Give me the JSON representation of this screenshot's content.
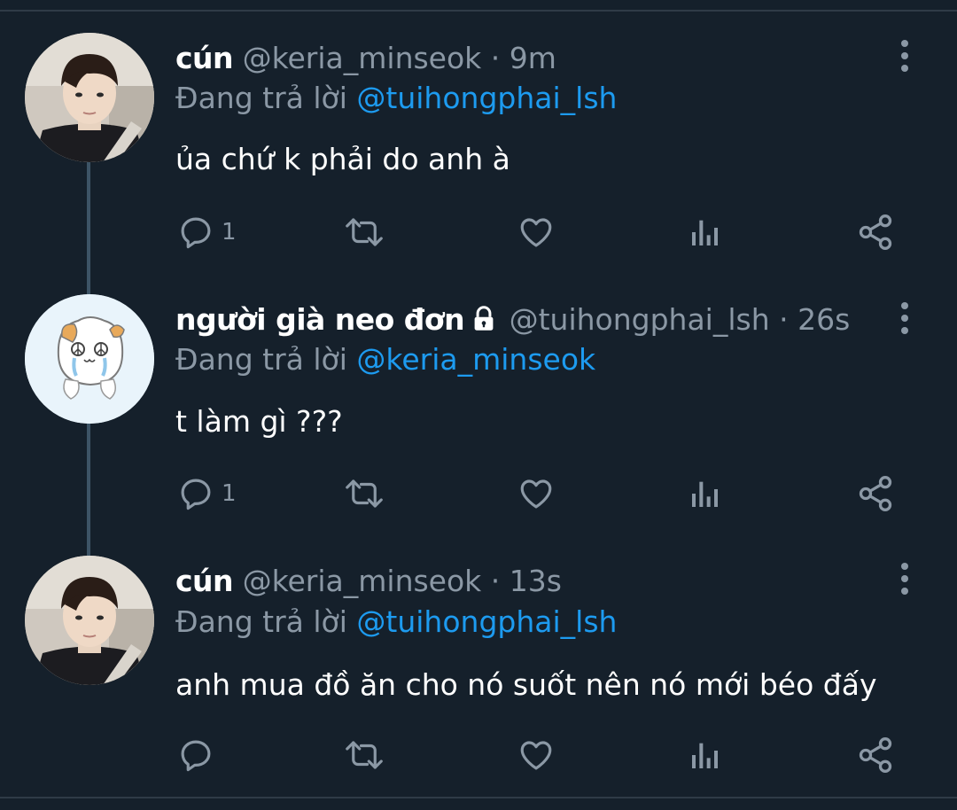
{
  "tweets": [
    {
      "name": "cún",
      "handle": "@keria_minseok",
      "separator": "·",
      "time": "9m",
      "reply_prefix": "Đang trả lời",
      "reply_to": "@tuihongphai_lsh",
      "text": "ủa chứ k phải do anh à",
      "reply_count": "1",
      "avatar": "photo-young-man",
      "locked": false
    },
    {
      "name": "người già neo đơn",
      "handle": "@tuihongphai_lsh",
      "separator": "·",
      "time": "26s",
      "reply_prefix": "Đang trả lời",
      "reply_to": "@keria_minseok",
      "text": "t làm gì ???",
      "reply_count": "1",
      "avatar": "cartoon-hamster-crying",
      "locked": true
    },
    {
      "name": "cún",
      "handle": "@keria_minseok",
      "separator": "·",
      "time": "13s",
      "reply_prefix": "Đang trả lời",
      "reply_to": "@tuihongphai_lsh",
      "text": "anh mua đồ ăn cho nó suốt nên nó mới béo đấy",
      "reply_count": "",
      "avatar": "photo-young-man",
      "locked": false
    }
  ],
  "icons": {
    "reply": "reply-icon",
    "retweet": "retweet-icon",
    "like": "heart-icon",
    "views": "analytics-icon",
    "share": "share-icon",
    "more": "more-vertical-icon",
    "lock": "lock-icon"
  },
  "colors": {
    "background": "#15202b",
    "text_primary": "#ffffff",
    "text_secondary": "#8b98a5",
    "mention": "#1d9bf0",
    "thread_line": "#3d5466"
  }
}
